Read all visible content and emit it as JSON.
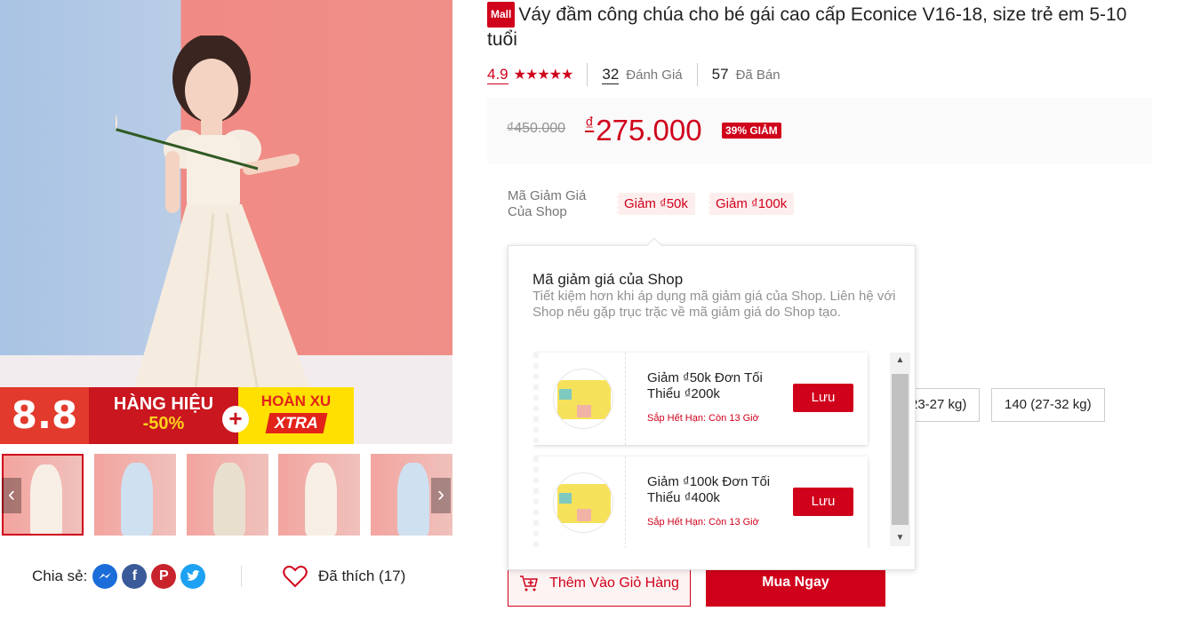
{
  "product": {
    "mall_badge": "Mall",
    "title": "Váy đầm công chúa cho bé gái cao cấp Econice V16-18, size trẻ em 5-10 tuổi",
    "rating": "4.9",
    "stars": "★★★★★",
    "review_count": "32",
    "review_label": "Đánh Giá",
    "sold_count": "57",
    "sold_label": "Đã Bán",
    "old_price": "₫450.000",
    "currency": "₫",
    "new_price": "275.000",
    "discount": "39% GIẢM"
  },
  "gallery": {
    "banner": {
      "big": "8.8",
      "hang_hieu": "HÀNG HIỆU",
      "hang_hieu_pct": "-50%",
      "plus": "+",
      "hoan_xu": "HOÀN XU",
      "xtra": "XTRA"
    },
    "thumb_prev": "‹",
    "thumb_next": "›",
    "thumbs": [
      {
        "color": "#f7efe6"
      },
      {
        "color": "#cfe0f1"
      },
      {
        "color": "#e9dfcf"
      },
      {
        "color": "#f7efe6"
      },
      {
        "color": "#cfe0f1"
      }
    ]
  },
  "share": {
    "label": "Chia sẻ:",
    "icons": [
      {
        "name": "messenger-icon",
        "color": "#1b6dd9",
        "glyph": "~"
      },
      {
        "name": "facebook-icon",
        "color": "#3b5a9a",
        "glyph": "f"
      },
      {
        "name": "pinterest-icon",
        "color": "#c8232c",
        "glyph": "P"
      },
      {
        "name": "twitter-icon",
        "color": "#1da1f2",
        "glyph": "t"
      }
    ],
    "liked_label": "Đã thích (17)"
  },
  "vouchers": {
    "label": "Mã Giảm Giá Của Shop",
    "chips": [
      "Giảm ₫50k",
      "Giảm ₫100k"
    ]
  },
  "sizes": {
    "partial_option": "23-27 kg)",
    "option": "140 (27-32 kg)"
  },
  "actions": {
    "add_to_cart": "Thêm Vào Giỏ Hàng",
    "buy_now": "Mua Ngay"
  },
  "popover": {
    "title": "Mã giảm giá của Shop",
    "description": "Tiết kiệm hơn khi áp dụng mã giảm giá của Shop. Liên hệ với Shop nếu gặp trục trặc về mã giảm giá do Shop tạo.",
    "items": [
      {
        "title": "Giảm ₫50k Đơn Tối Thiểu ₫200k",
        "expiry": "Sắp Hết Hạn: Còn 13 Giờ",
        "save": "Lưu"
      },
      {
        "title": "Giảm ₫100k Đơn Tối Thiểu ₫400k",
        "expiry": "Sắp Hết Hạn: Còn 13 Giờ",
        "save": "Lưu"
      }
    ],
    "scroll_up": "▲",
    "scroll_down": "▼"
  },
  "colors": {
    "brand_red": "#d0011b"
  }
}
